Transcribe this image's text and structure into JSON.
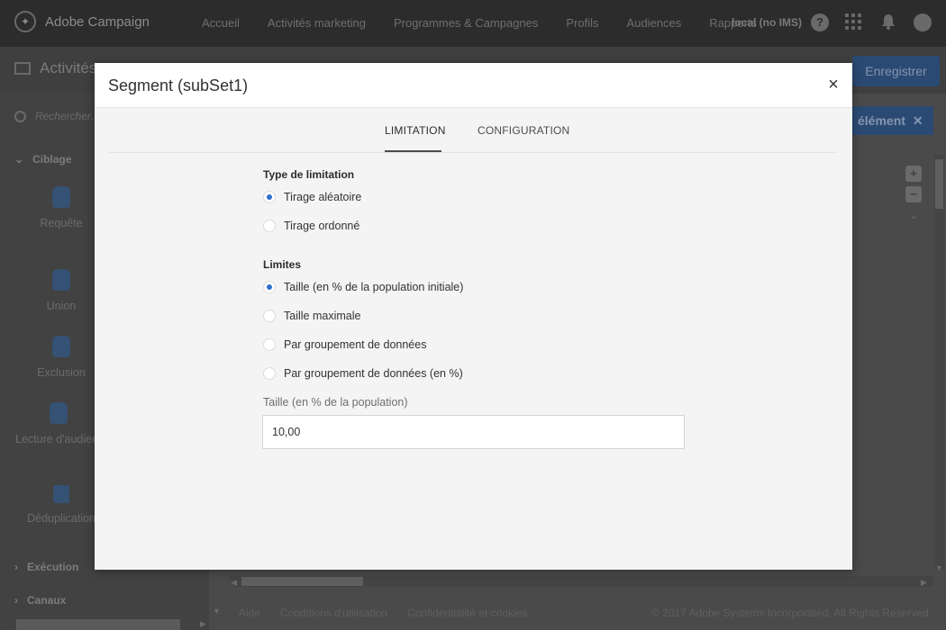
{
  "app": {
    "brand": "Adobe Campaign",
    "nav": [
      "Accueil",
      "Activités marketing",
      "Programmes & Campagnes",
      "Profils",
      "Audiences",
      "Rapports"
    ],
    "user_label": "local (no IMS)",
    "help_label": "?"
  },
  "page": {
    "title": "Activités",
    "save_label": "Enregistrer",
    "add_element_label": "élément",
    "search_placeholder": "Rechercher..."
  },
  "sidebar": {
    "sections": [
      {
        "label": "Ciblage"
      },
      {
        "label": "Exécution"
      },
      {
        "label": "Canaux"
      }
    ],
    "tools": [
      {
        "label": "Requête"
      },
      {
        "label": "Union"
      },
      {
        "label": "Exclusion"
      },
      {
        "label": "Lecture d'audience"
      },
      {
        "label": "Déduplication"
      }
    ]
  },
  "footer": {
    "links": [
      "Aide",
      "Conditions d'utilisation",
      "Confidentialité et cookies"
    ],
    "copyright": "© 2017 Adobe Systems Incorporated. All Rights Reserved."
  },
  "modal": {
    "title": "Segment (subSet1)",
    "close_glyph": "×",
    "tabs": [
      {
        "label": "LIMITATION",
        "active": true
      },
      {
        "label": "CONFIGURATION",
        "active": false
      }
    ],
    "limitation_type": {
      "label": "Type de limitation",
      "options": [
        {
          "label": "Tirage aléatoire",
          "selected": true
        },
        {
          "label": "Tirage ordonné",
          "selected": false
        }
      ]
    },
    "limits": {
      "label": "Limites",
      "options": [
        {
          "label": "Taille (en % de la population initiale)",
          "selected": true
        },
        {
          "label": "Taille maximale",
          "selected": false
        },
        {
          "label": "Par groupement de données",
          "selected": false
        },
        {
          "label": "Par groupement de données (en %)",
          "selected": false
        }
      ]
    },
    "size_field": {
      "label": "Taille (en % de la population)",
      "value": "10,00"
    }
  },
  "colors": {
    "accent": "#2d6fcd",
    "primary_button": "#2b4a73"
  }
}
